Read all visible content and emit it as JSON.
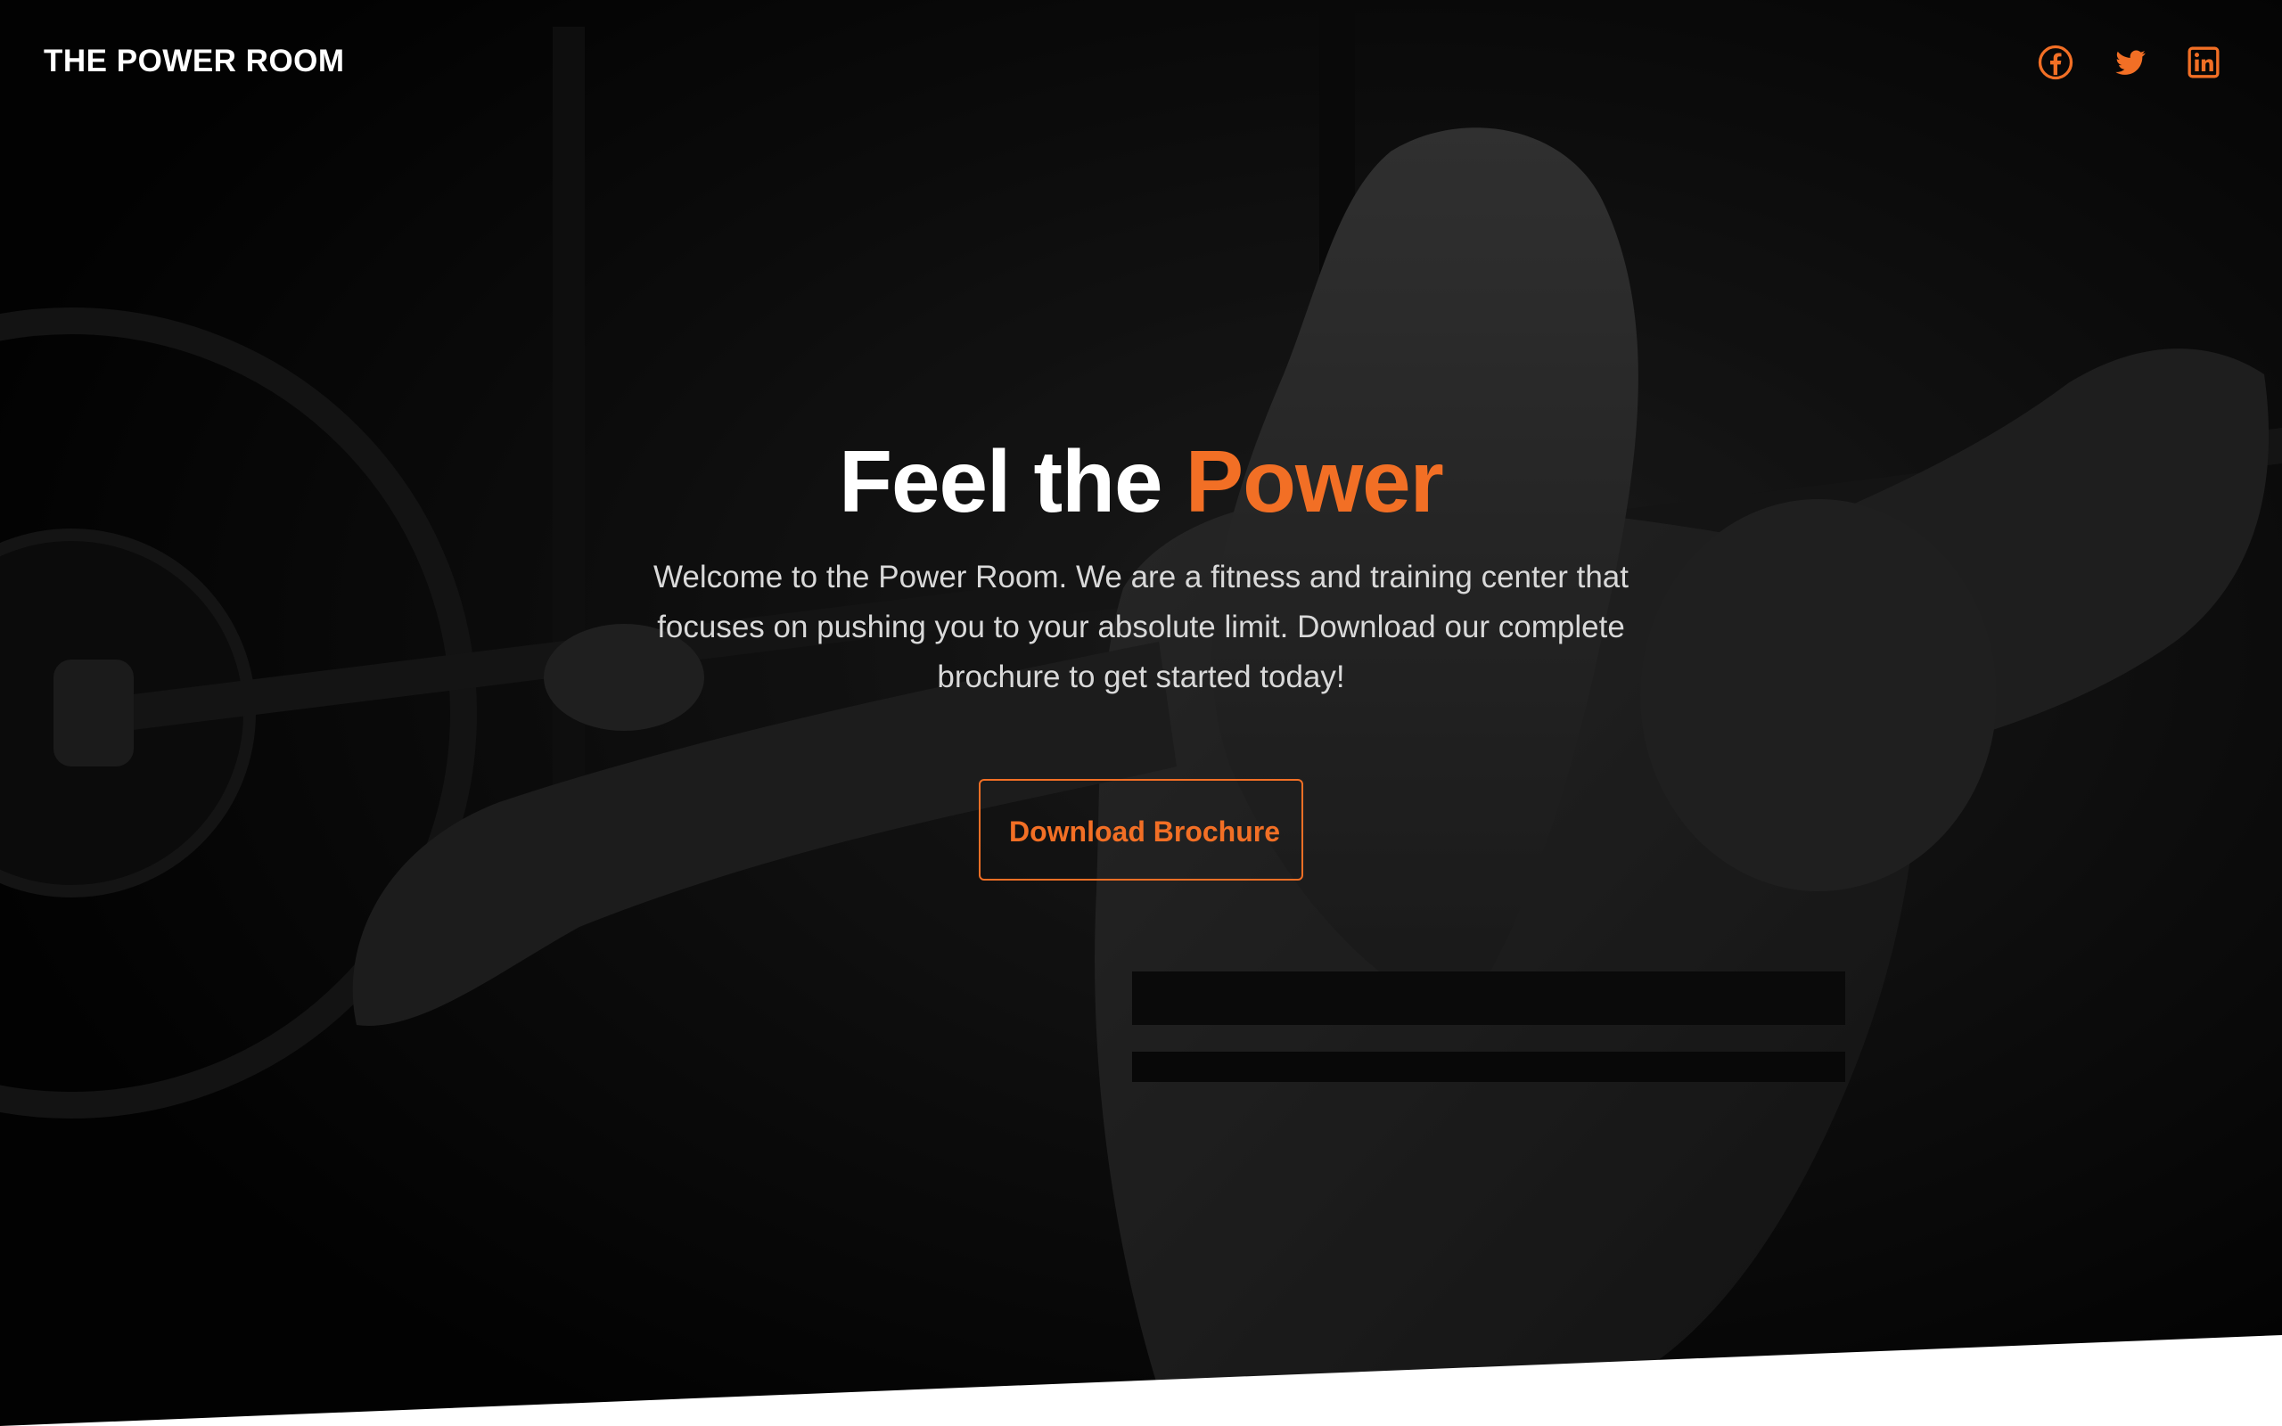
{
  "site": {
    "brand": "THE POWER ROOM"
  },
  "social": [
    {
      "name": "facebook-icon",
      "color": "#f26f25"
    },
    {
      "name": "twitter-icon",
      "color": "#f26f25"
    },
    {
      "name": "linkedin-icon",
      "color": "#f26f25"
    }
  ],
  "hero": {
    "headline_prefix": "Feel the",
    "headline_accent": "Power",
    "lead": "Welcome to the Power Room. We are a fitness and training center that focuses on pushing you to your absolute limit. Download our complete brochure to get started today!",
    "cta_label": "Download Brochure"
  },
  "colors": {
    "accent": "#f26f25",
    "text": "#ffffff",
    "muted_text": "#d9d9d9",
    "background": "#080808"
  }
}
